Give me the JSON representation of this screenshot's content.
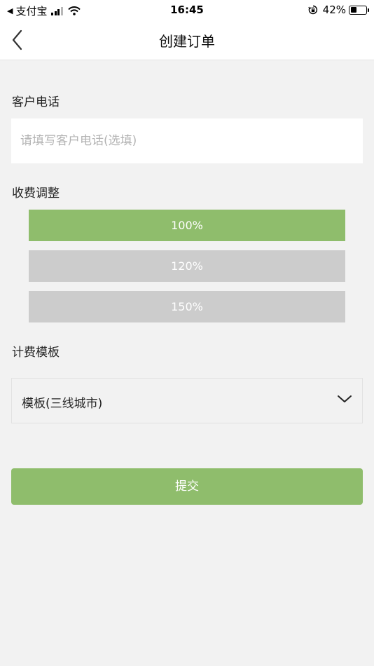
{
  "status_bar": {
    "carrier": "支付宝",
    "time": "16:45",
    "battery": "42%",
    "icons": [
      "back-triangle-icon",
      "signal-icon",
      "wifi-icon",
      "orientation-lock-icon",
      "battery-icon"
    ],
    "battery_level": 0.42
  },
  "nav": {
    "title": "创建订单",
    "back_icon": "chevron-left-icon"
  },
  "phone": {
    "label": "客户电话",
    "placeholder": "请填写客户电话(选填)",
    "value": ""
  },
  "fee": {
    "label": "收费调整",
    "options": [
      {
        "label": "100%",
        "selected": true
      },
      {
        "label": "120%",
        "selected": false
      },
      {
        "label": "150%",
        "selected": false
      }
    ]
  },
  "template": {
    "label": "计费模板",
    "selected": "模板(三线城市)",
    "icon": "chevron-down-icon"
  },
  "submit": {
    "label": "提交"
  },
  "colors": {
    "accent": "#8fbd6c",
    "inactive": "#cccccc",
    "background": "#f2f2f2"
  }
}
